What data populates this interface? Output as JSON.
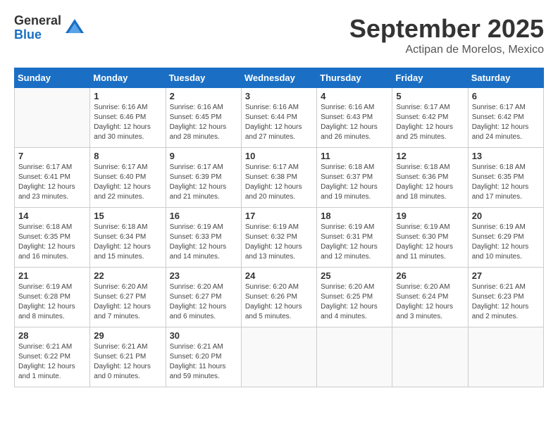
{
  "header": {
    "logo_general": "General",
    "logo_blue": "Blue",
    "month": "September 2025",
    "location": "Actipan de Morelos, Mexico"
  },
  "weekdays": [
    "Sunday",
    "Monday",
    "Tuesday",
    "Wednesday",
    "Thursday",
    "Friday",
    "Saturday"
  ],
  "weeks": [
    [
      {
        "day": "",
        "info": ""
      },
      {
        "day": "1",
        "info": "Sunrise: 6:16 AM\nSunset: 6:46 PM\nDaylight: 12 hours\nand 30 minutes."
      },
      {
        "day": "2",
        "info": "Sunrise: 6:16 AM\nSunset: 6:45 PM\nDaylight: 12 hours\nand 28 minutes."
      },
      {
        "day": "3",
        "info": "Sunrise: 6:16 AM\nSunset: 6:44 PM\nDaylight: 12 hours\nand 27 minutes."
      },
      {
        "day": "4",
        "info": "Sunrise: 6:16 AM\nSunset: 6:43 PM\nDaylight: 12 hours\nand 26 minutes."
      },
      {
        "day": "5",
        "info": "Sunrise: 6:17 AM\nSunset: 6:42 PM\nDaylight: 12 hours\nand 25 minutes."
      },
      {
        "day": "6",
        "info": "Sunrise: 6:17 AM\nSunset: 6:42 PM\nDaylight: 12 hours\nand 24 minutes."
      }
    ],
    [
      {
        "day": "7",
        "info": "Sunrise: 6:17 AM\nSunset: 6:41 PM\nDaylight: 12 hours\nand 23 minutes."
      },
      {
        "day": "8",
        "info": "Sunrise: 6:17 AM\nSunset: 6:40 PM\nDaylight: 12 hours\nand 22 minutes."
      },
      {
        "day": "9",
        "info": "Sunrise: 6:17 AM\nSunset: 6:39 PM\nDaylight: 12 hours\nand 21 minutes."
      },
      {
        "day": "10",
        "info": "Sunrise: 6:17 AM\nSunset: 6:38 PM\nDaylight: 12 hours\nand 20 minutes."
      },
      {
        "day": "11",
        "info": "Sunrise: 6:18 AM\nSunset: 6:37 PM\nDaylight: 12 hours\nand 19 minutes."
      },
      {
        "day": "12",
        "info": "Sunrise: 6:18 AM\nSunset: 6:36 PM\nDaylight: 12 hours\nand 18 minutes."
      },
      {
        "day": "13",
        "info": "Sunrise: 6:18 AM\nSunset: 6:35 PM\nDaylight: 12 hours\nand 17 minutes."
      }
    ],
    [
      {
        "day": "14",
        "info": "Sunrise: 6:18 AM\nSunset: 6:35 PM\nDaylight: 12 hours\nand 16 minutes."
      },
      {
        "day": "15",
        "info": "Sunrise: 6:18 AM\nSunset: 6:34 PM\nDaylight: 12 hours\nand 15 minutes."
      },
      {
        "day": "16",
        "info": "Sunrise: 6:19 AM\nSunset: 6:33 PM\nDaylight: 12 hours\nand 14 minutes."
      },
      {
        "day": "17",
        "info": "Sunrise: 6:19 AM\nSunset: 6:32 PM\nDaylight: 12 hours\nand 13 minutes."
      },
      {
        "day": "18",
        "info": "Sunrise: 6:19 AM\nSunset: 6:31 PM\nDaylight: 12 hours\nand 12 minutes."
      },
      {
        "day": "19",
        "info": "Sunrise: 6:19 AM\nSunset: 6:30 PM\nDaylight: 12 hours\nand 11 minutes."
      },
      {
        "day": "20",
        "info": "Sunrise: 6:19 AM\nSunset: 6:29 PM\nDaylight: 12 hours\nand 10 minutes."
      }
    ],
    [
      {
        "day": "21",
        "info": "Sunrise: 6:19 AM\nSunset: 6:28 PM\nDaylight: 12 hours\nand 8 minutes."
      },
      {
        "day": "22",
        "info": "Sunrise: 6:20 AM\nSunset: 6:27 PM\nDaylight: 12 hours\nand 7 minutes."
      },
      {
        "day": "23",
        "info": "Sunrise: 6:20 AM\nSunset: 6:27 PM\nDaylight: 12 hours\nand 6 minutes."
      },
      {
        "day": "24",
        "info": "Sunrise: 6:20 AM\nSunset: 6:26 PM\nDaylight: 12 hours\nand 5 minutes."
      },
      {
        "day": "25",
        "info": "Sunrise: 6:20 AM\nSunset: 6:25 PM\nDaylight: 12 hours\nand 4 minutes."
      },
      {
        "day": "26",
        "info": "Sunrise: 6:20 AM\nSunset: 6:24 PM\nDaylight: 12 hours\nand 3 minutes."
      },
      {
        "day": "27",
        "info": "Sunrise: 6:21 AM\nSunset: 6:23 PM\nDaylight: 12 hours\nand 2 minutes."
      }
    ],
    [
      {
        "day": "28",
        "info": "Sunrise: 6:21 AM\nSunset: 6:22 PM\nDaylight: 12 hours\nand 1 minute."
      },
      {
        "day": "29",
        "info": "Sunrise: 6:21 AM\nSunset: 6:21 PM\nDaylight: 12 hours\nand 0 minutes."
      },
      {
        "day": "30",
        "info": "Sunrise: 6:21 AM\nSunset: 6:20 PM\nDaylight: 11 hours\nand 59 minutes."
      },
      {
        "day": "",
        "info": ""
      },
      {
        "day": "",
        "info": ""
      },
      {
        "day": "",
        "info": ""
      },
      {
        "day": "",
        "info": ""
      }
    ]
  ]
}
